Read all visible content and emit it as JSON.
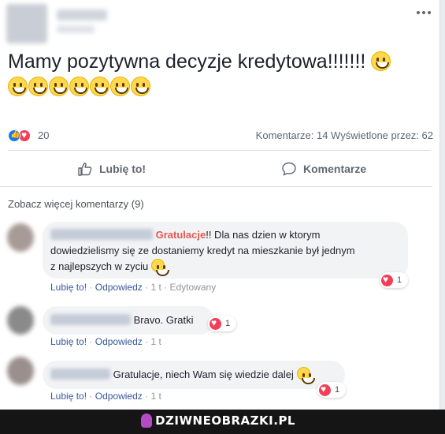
{
  "post": {
    "text": "Mamy pozytywna decyzje kredytowa!!!!!!!",
    "emoji_count_line1": 1,
    "emoji_count_line2": 7,
    "emoji_icon": "grinning-face-icon"
  },
  "stats": {
    "reaction_count": "20",
    "comments_views": "Komentarze: 14  Wyświetlone przez: 62"
  },
  "actions": {
    "like_label": "Lubię to!",
    "comment_label": "Komentarze"
  },
  "more_comments": "Zobacz więcej komentarzy (9)",
  "comments": [
    {
      "highlight": "Gratulacje",
      "text_line1": "!! Dla nas dzien w ktorym",
      "text_line2": "dowiedzielismy się ze dostaniemy kredyt na mieszkanie był jednym",
      "text_line3": "z najlepszych w zyciu",
      "like": "Lubię to!",
      "reply": "Odpowiedz",
      "time": "1 t",
      "edited": "Edytowany",
      "reaction_count": "1"
    },
    {
      "text": "Bravo. Gratki",
      "like": "Lubię to!",
      "reply": "Odpowiedz",
      "time": "1 t",
      "reaction_count": "1"
    },
    {
      "text": "Gratulacje, niech Wam się wiedzie dalej",
      "like": "Lubię to!",
      "reply": "Odpowiedz",
      "time": "1 t",
      "reaction_count": "1"
    }
  ],
  "watermark": "DZIWNEOBRAZKI.PL",
  "colors": {
    "like_blue": "#1877f2",
    "love_red": "#f33e58",
    "link_blue": "#385898",
    "highlight": "#e2594f"
  }
}
